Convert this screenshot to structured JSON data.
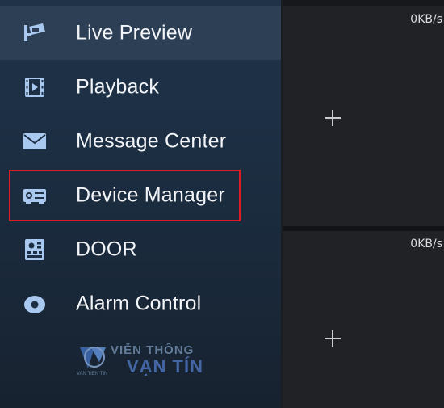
{
  "menu": {
    "items": [
      {
        "label": "Live Preview",
        "icon": "camera-icon",
        "active": true
      },
      {
        "label": "Playback",
        "icon": "film-icon",
        "active": false
      },
      {
        "label": "Message Center",
        "icon": "envelope-icon",
        "active": false
      },
      {
        "label": "Device Manager",
        "icon": "device-icon",
        "active": false,
        "highlighted": true
      },
      {
        "label": "DOOR",
        "icon": "door-panel-icon",
        "active": false
      },
      {
        "label": "Alarm Control",
        "icon": "alarm-disc-icon",
        "active": false
      }
    ]
  },
  "panes": [
    {
      "speed": "0KB/s"
    },
    {
      "speed": "0KB/s"
    }
  ],
  "watermark": {
    "line1": "VIỄN THÔNG",
    "line2": "VẠN TÍN",
    "small": "VAN TIEN TIN"
  },
  "colors": {
    "highlight": "#e01b24",
    "icon": "#a9c8ef",
    "drawer_bg": "#1d2f44",
    "active_bg": "#2c3f54"
  }
}
